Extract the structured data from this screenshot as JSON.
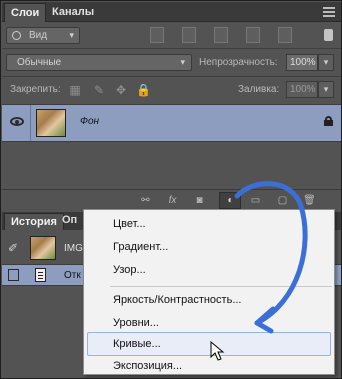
{
  "layers_panel": {
    "tabs": [
      {
        "label": "Слои",
        "active": true
      },
      {
        "label": "Каналы",
        "active": false
      }
    ],
    "filter": {
      "value": "Вид"
    },
    "blend_mode": "Обычные",
    "opacity_label": "Непрозрачность:",
    "opacity_value": "100%",
    "lock_label": "Закрепить:",
    "fill_label": "Заливка:",
    "fill_value": "100%",
    "layer": {
      "name": "Фон",
      "locked": true
    }
  },
  "history_panel": {
    "tabs": [
      {
        "label": "История"
      },
      {
        "label": "Оп"
      }
    ],
    "snapshot_name": "IMG",
    "step_name": "Отк"
  },
  "context_menu": {
    "group1": [
      "Цвет...",
      "Градиент...",
      "Узор..."
    ],
    "group2": [
      "Яркость/Контрастность...",
      "Уровни...",
      "Кривые...",
      "Экспозиция..."
    ],
    "highlighted": "Кривые..."
  },
  "colors": {
    "selection": "#8c9dbf",
    "arrow": "#3b6fd6"
  }
}
